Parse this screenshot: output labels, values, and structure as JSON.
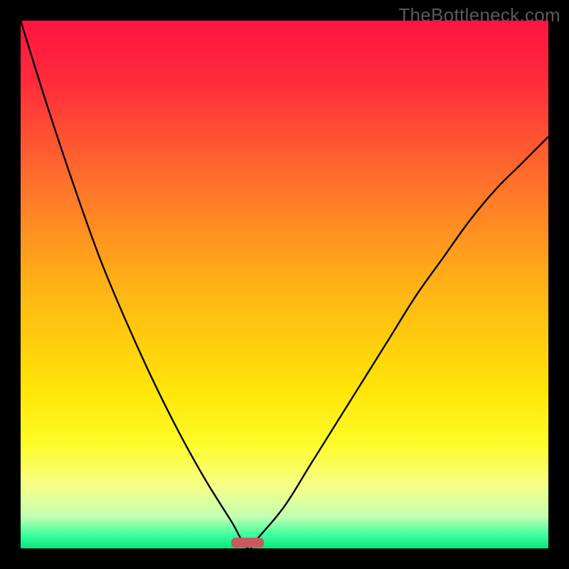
{
  "watermark": "TheBottleneck.com",
  "chart_data": {
    "type": "line",
    "title": "",
    "xlabel": "",
    "ylabel": "",
    "xlim": [
      0,
      100
    ],
    "ylim": [
      0,
      100
    ],
    "grid": false,
    "legend": false,
    "notes": "Axes unlabeled; values estimated from curve shape. Bottleneck curve with minimum near x≈43. Marker at bottom near minimum. Gradient background red→orange→yellow→green top→bottom.",
    "series": [
      {
        "name": "bottleneck-curve",
        "x": [
          0,
          5,
          10,
          15,
          20,
          25,
          30,
          35,
          40,
          43,
          45,
          50,
          55,
          60,
          65,
          70,
          75,
          80,
          85,
          90,
          95,
          100
        ],
        "y": [
          100,
          84,
          69,
          55,
          43,
          32,
          22,
          13,
          5,
          0,
          2,
          8,
          16,
          24,
          32,
          40,
          48,
          55,
          62,
          68,
          73,
          78
        ]
      }
    ],
    "markers": [
      {
        "name": "optimal-marker",
        "x": 43,
        "y": 0,
        "shape": "rounded-bar",
        "color": "#c85a5e"
      }
    ],
    "background_gradient": {
      "stops": [
        {
          "offset": 0.0,
          "color": "#ff1342"
        },
        {
          "offset": 0.12,
          "color": "#ff2d3a"
        },
        {
          "offset": 0.3,
          "color": "#ff6f2c"
        },
        {
          "offset": 0.5,
          "color": "#ffb215"
        },
        {
          "offset": 0.7,
          "color": "#ffe508"
        },
        {
          "offset": 0.8,
          "color": "#fffb27"
        },
        {
          "offset": 0.88,
          "color": "#f6ff86"
        },
        {
          "offset": 0.94,
          "color": "#c2ffb2"
        },
        {
          "offset": 0.975,
          "color": "#3bff9f"
        },
        {
          "offset": 1.0,
          "color": "#07e57d"
        }
      ]
    }
  }
}
